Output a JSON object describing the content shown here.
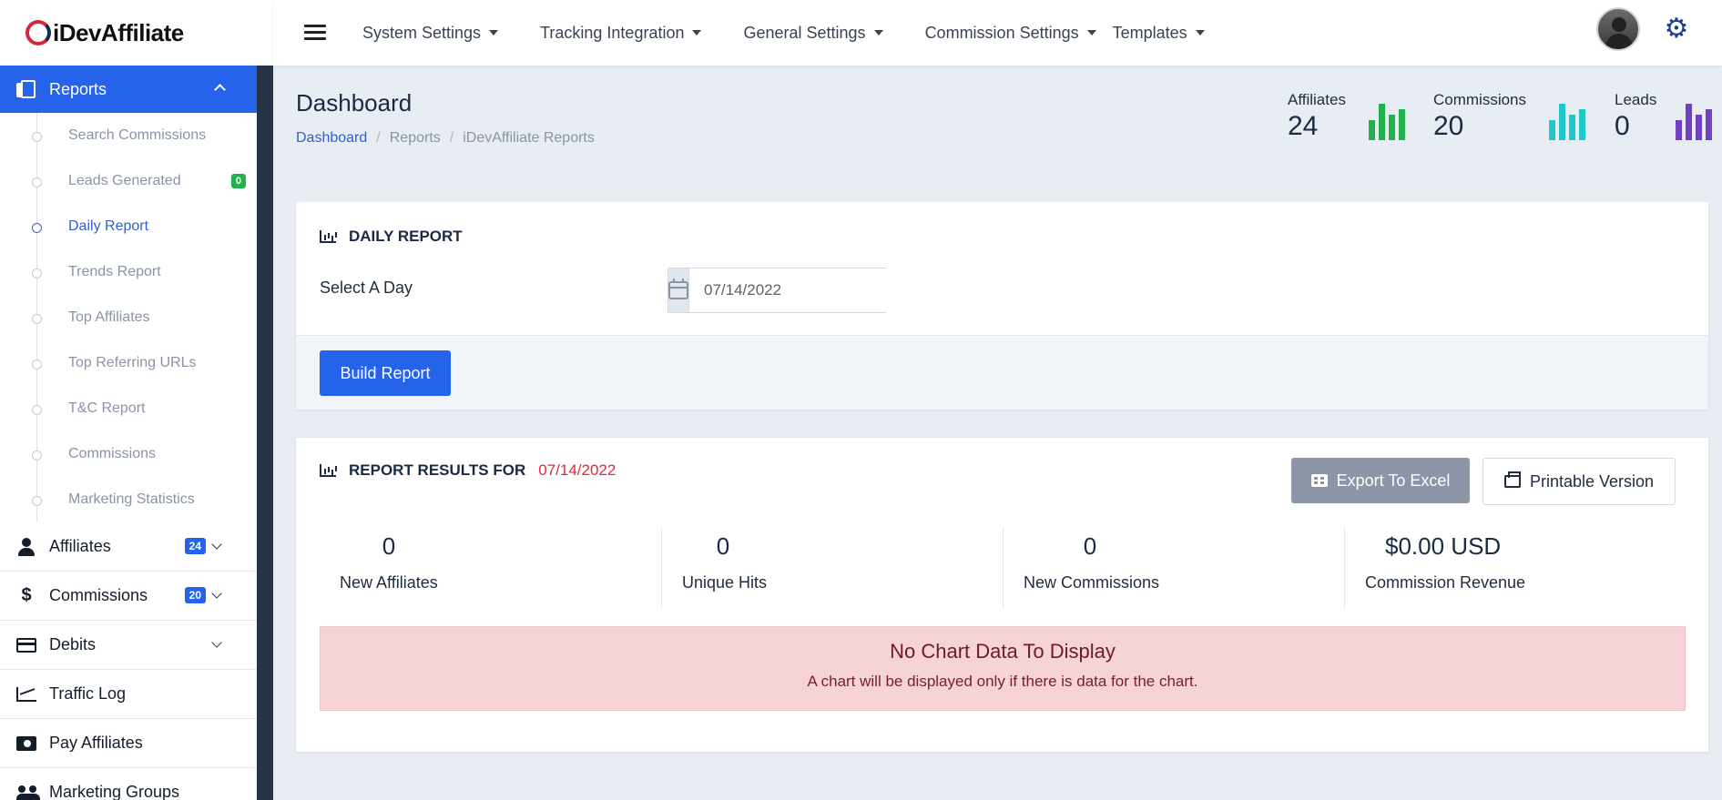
{
  "app": {
    "logo_text": "iDevAffiliate"
  },
  "sidebar": {
    "reports_label": "Reports",
    "report_items": [
      {
        "label": "Search Commissions"
      },
      {
        "label": "Leads Generated",
        "badge": "0"
      },
      {
        "label": "Daily Report",
        "active": true
      },
      {
        "label": "Trends Report"
      },
      {
        "label": "Top Affiliates"
      },
      {
        "label": "Top Referring URLs"
      },
      {
        "label": "T&C Report"
      },
      {
        "label": "Commissions"
      },
      {
        "label": "Marketing Statistics"
      }
    ],
    "main_items": [
      {
        "label": "Affiliates",
        "badge": "24",
        "icon": "person-icon"
      },
      {
        "label": "Commissions",
        "badge": "20",
        "icon": "dollar-icon"
      },
      {
        "label": "Debits",
        "icon": "credit-card-icon"
      },
      {
        "label": "Traffic Log",
        "icon": "line-chart-icon"
      },
      {
        "label": "Pay Affiliates",
        "icon": "money-icon"
      },
      {
        "label": "Marketing Groups",
        "icon": "users-icon"
      }
    ]
  },
  "topnav": {
    "items": [
      "System Settings",
      "Tracking Integration",
      "General Settings",
      "Commission Settings",
      "Templates"
    ]
  },
  "header": {
    "title": "Dashboard",
    "breadcrumb": [
      "Dashboard",
      "Reports",
      "iDevAffiliate Reports"
    ],
    "stats": [
      {
        "label": "Affiliates",
        "value": "24",
        "color": "#22b14c"
      },
      {
        "label": "Commissions",
        "value": "20",
        "color": "#1fc8c8"
      },
      {
        "label": "Leads",
        "value": "0",
        "color": "#6f42c1"
      }
    ]
  },
  "daily_report": {
    "title": "DAILY REPORT",
    "select_label": "Select A Day",
    "date_value": "07/14/2022",
    "build_button": "Build Report"
  },
  "results": {
    "title": "REPORT RESULTS FOR",
    "date": "07/14/2022",
    "export_button": "Export To Excel",
    "print_button": "Printable Version",
    "metrics": [
      {
        "value": "0",
        "label": "New Affiliates"
      },
      {
        "value": "0",
        "label": "Unique Hits"
      },
      {
        "value": "0",
        "label": "New Commissions"
      },
      {
        "value": "$0.00 USD",
        "label": "Commission Revenue"
      }
    ],
    "no_data_title": "No Chart Data To Display",
    "no_data_text": "A chart will be displayed only if there is data for the chart."
  },
  "colors": {
    "accent": "#2563eb",
    "danger": "#e0283e",
    "sidebar_dark": "#253447"
  }
}
